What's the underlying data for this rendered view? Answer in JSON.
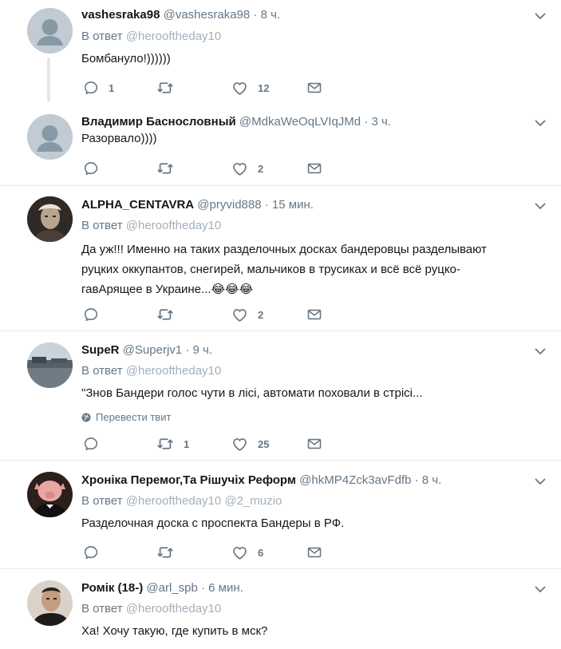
{
  "tweets": [
    {
      "name": "vashesraka98",
      "handle": "@vashesraka98",
      "time": "8 ч.",
      "reply_prefix": "В ответ",
      "reply_mentions": "@herooftheday10",
      "text": "Бомбануло!))))))",
      "replies": "1",
      "retweets": "",
      "likes": "12"
    },
    {
      "name": "Владимир Баснословный",
      "handle": "@MdkaWeOqLVIqJMd",
      "time": "3 ч.",
      "text": "Разорвало))))",
      "replies": "",
      "retweets": "",
      "likes": "2"
    },
    {
      "name": "ALPHA_CENTAVRA",
      "handle": "@pryvid888",
      "time": "15 мин.",
      "reply_prefix": "В ответ",
      "reply_mentions": "@herooftheday10",
      "text_line1": "Да уж!!! Именно на таких разделочных досках бандеровцы разделывают",
      "text_line2": "руцких оккупантов, снегирей, мальчиков в трусиках и всё всё руцко-",
      "text_line3": "гавАрящее в Украине...",
      "emoji": "😂😂😂",
      "replies": "",
      "retweets": "",
      "likes": "2"
    },
    {
      "name": "SupeR",
      "handle": "@Superjv1",
      "time": "9 ч.",
      "reply_prefix": "В ответ",
      "reply_mentions": "@herooftheday10",
      "text": "\"Знов Бандери голос чути в лісі, автомати поховали в стрісі...",
      "translate": "Перевести твит",
      "replies": "",
      "retweets": "1",
      "likes": "25"
    },
    {
      "name": "Хроніка Перемог,Та Рішучіх Реформ",
      "handle": "@hkMP4Zck3avFdfb",
      "time": "8 ч.",
      "reply_prefix": "В ответ",
      "reply_mentions": "@herooftheday10 @2_muzio",
      "text": "Разделочная доска с проспекта Бандеры в РФ.",
      "replies": "",
      "retweets": "",
      "likes": "6"
    },
    {
      "name": "Ромік (18-)",
      "handle": "@arl_spb",
      "time": "6 мин.",
      "reply_prefix": "В ответ",
      "reply_mentions": "@herooftheday10",
      "text": "Ха! Хочу такую, где купить в мск?"
    }
  ],
  "separator": "·",
  "icons": {
    "reply": "reply-icon",
    "retweet": "retweet-icon",
    "like": "heart-icon",
    "dm": "envelope-icon",
    "menu": "chevron-down-icon",
    "globe": "globe-icon"
  },
  "colors": {
    "text": "#14171a",
    "secondary": "#657786",
    "divider": "#e6ecf0",
    "default_avatar": "#c2cbd3"
  }
}
